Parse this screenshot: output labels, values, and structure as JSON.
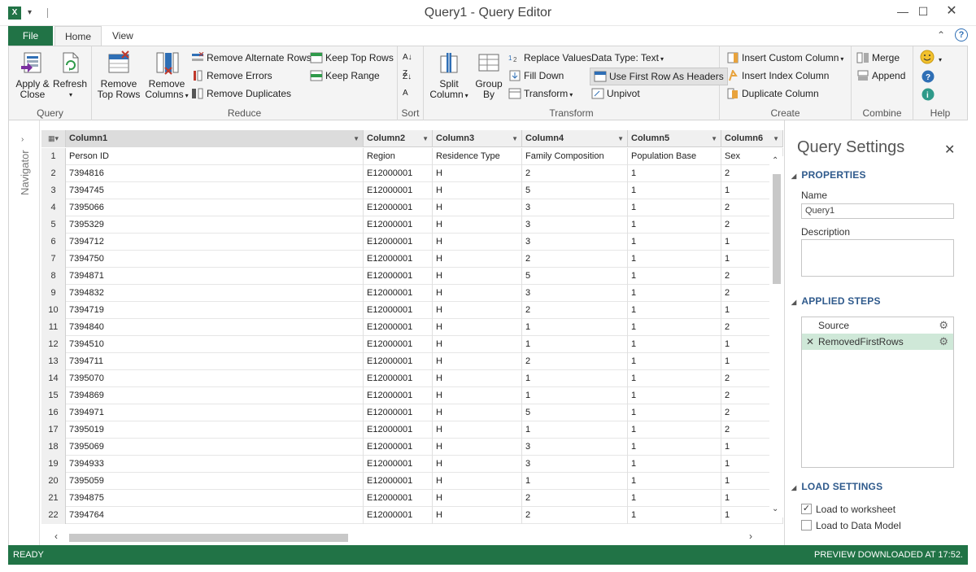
{
  "window": {
    "title": "Query1 - Query Editor",
    "app_icon": "X",
    "min": "—",
    "max": "☐",
    "close": "✕"
  },
  "tabs": {
    "file": "File",
    "home": "Home",
    "view": "View"
  },
  "ribbon": {
    "query": {
      "label": "Query",
      "apply_close": [
        "Apply &",
        "Close"
      ],
      "refresh": "Refresh"
    },
    "reduce": {
      "label": "Reduce",
      "remove_top_rows": [
        "Remove",
        "Top Rows"
      ],
      "remove_columns": [
        "Remove",
        "Columns"
      ],
      "remove_alternate_rows": "Remove Alternate Rows",
      "remove_errors": "Remove Errors",
      "remove_duplicates": "Remove Duplicates",
      "keep_top_rows": "Keep Top Rows",
      "keep_range": "Keep Range"
    },
    "sort": {
      "label": "Sort"
    },
    "transform": {
      "label": "Transform",
      "split_column": [
        "Split",
        "Column"
      ],
      "group_by": [
        "Group",
        "By"
      ],
      "replace_values": "Replace Values",
      "fill_down": "Fill Down",
      "transform": "Transform",
      "data_type": "Data Type: Text",
      "use_first_row": "Use First Row As Headers",
      "unpivot": "Unpivot"
    },
    "create": {
      "label": "Create",
      "insert_custom_column": "Insert Custom Column",
      "insert_index_column": "Insert Index Column",
      "duplicate_column": "Duplicate Column"
    },
    "combine": {
      "label": "Combine",
      "merge": "Merge",
      "append": "Append"
    },
    "help": {
      "label": "Help"
    }
  },
  "navigator": {
    "label": "Navigator"
  },
  "grid": {
    "columns": [
      "Column1",
      "Column2",
      "Column3",
      "Column4",
      "Column5",
      "Column6"
    ],
    "rows": [
      [
        "1",
        "Person ID",
        "Region",
        "Residence Type",
        "Family Composition",
        "Population Base",
        "Sex"
      ],
      [
        "2",
        "7394816",
        "E12000001",
        "H",
        "2",
        "1",
        "2"
      ],
      [
        "3",
        "7394745",
        "E12000001",
        "H",
        "5",
        "1",
        "1"
      ],
      [
        "4",
        "7395066",
        "E12000001",
        "H",
        "3",
        "1",
        "2"
      ],
      [
        "5",
        "7395329",
        "E12000001",
        "H",
        "3",
        "1",
        "2"
      ],
      [
        "6",
        "7394712",
        "E12000001",
        "H",
        "3",
        "1",
        "1"
      ],
      [
        "7",
        "7394750",
        "E12000001",
        "H",
        "2",
        "1",
        "1"
      ],
      [
        "8",
        "7394871",
        "E12000001",
        "H",
        "5",
        "1",
        "2"
      ],
      [
        "9",
        "7394832",
        "E12000001",
        "H",
        "3",
        "1",
        "2"
      ],
      [
        "10",
        "7394719",
        "E12000001",
        "H",
        "2",
        "1",
        "1"
      ],
      [
        "11",
        "7394840",
        "E12000001",
        "H",
        "1",
        "1",
        "2"
      ],
      [
        "12",
        "7394510",
        "E12000001",
        "H",
        "1",
        "1",
        "1"
      ],
      [
        "13",
        "7394711",
        "E12000001",
        "H",
        "2",
        "1",
        "1"
      ],
      [
        "14",
        "7395070",
        "E12000001",
        "H",
        "1",
        "1",
        "2"
      ],
      [
        "15",
        "7394869",
        "E12000001",
        "H",
        "1",
        "1",
        "2"
      ],
      [
        "16",
        "7394971",
        "E12000001",
        "H",
        "5",
        "1",
        "2"
      ],
      [
        "17",
        "7395019",
        "E12000001",
        "H",
        "1",
        "1",
        "2"
      ],
      [
        "18",
        "7395069",
        "E12000001",
        "H",
        "3",
        "1",
        "1"
      ],
      [
        "19",
        "7394933",
        "E12000001",
        "H",
        "3",
        "1",
        "1"
      ],
      [
        "20",
        "7395059",
        "E12000001",
        "H",
        "1",
        "1",
        "1"
      ],
      [
        "21",
        "7394875",
        "E12000001",
        "H",
        "2",
        "1",
        "1"
      ],
      [
        "22",
        "7394764",
        "E12000001",
        "H",
        "2",
        "1",
        "1"
      ]
    ]
  },
  "query_settings": {
    "title": "Query Settings",
    "properties": "PROPERTIES",
    "name_label": "Name",
    "name_value": "Query1",
    "description_label": "Description",
    "applied_steps": "APPLIED STEPS",
    "steps": [
      "Source",
      "RemovedFirstRows"
    ],
    "load_settings": "LOAD SETTINGS",
    "load_to_worksheet": "Load to worksheet",
    "load_to_data_model": "Load to Data Model"
  },
  "status": {
    "left": "READY",
    "right": "PREVIEW DOWNLOADED AT 17:52."
  },
  "colors": {
    "accent": "#217346",
    "section_title": "#2f5a8c",
    "selected_step": "#cfe8d8"
  }
}
